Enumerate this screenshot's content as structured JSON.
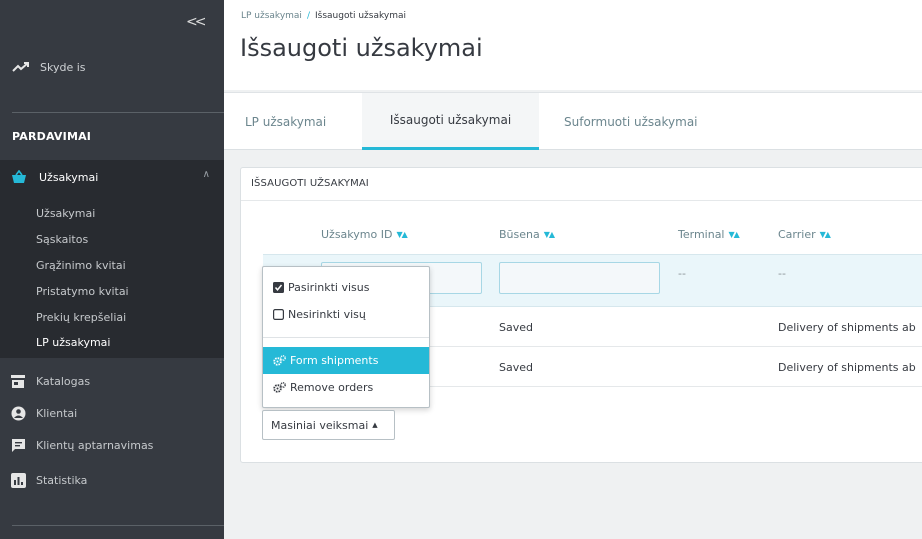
{
  "sidebar": {
    "dashboard_label": "Skyde is",
    "section_header": "PARDAVIMAI",
    "orders_label": "Užsakymai",
    "submenu": [
      "Užsakymai",
      "Sąskaitos",
      "Grąžinimo kvitai",
      "Pristatymo kvitai",
      "Prekių krepšeliai",
      "LP užsakymai"
    ],
    "nav": [
      "Katalogas",
      "Klientai",
      "Klientų aptarnavimas",
      "Statistika"
    ]
  },
  "header": {
    "breadcrumb_parent": "LP užsakymai",
    "breadcrumb_sep": "/",
    "breadcrumb_current": "Išsaugoti užsakymai",
    "title": "Išsaugoti užsakymai"
  },
  "tabs": [
    "LP užsakymai",
    "Išsaugoti užsakymai",
    "Suformuoti užsakymai"
  ],
  "card": {
    "heading": "IŠSAUGOTI UŽSAKYMAI",
    "columns": [
      "Užsakymo ID",
      "Būsena",
      "Terminal",
      "Carrier"
    ],
    "filter_dash": "--",
    "rows": [
      {
        "status": "Saved",
        "carrier": "Delivery of shipments ab"
      },
      {
        "status": "Saved",
        "carrier": "Delivery of shipments ab"
      }
    ]
  },
  "bulk": {
    "button_label": "Masiniai veiksmai",
    "menu": {
      "select_all": "Pasirinkti visus",
      "deselect_all": "Nesirinkti visų",
      "form_shipments": "Form shipments",
      "remove_orders": "Remove orders"
    }
  },
  "colors": {
    "accent": "#25b9d7",
    "sidebar_bg": "#363a41",
    "sidebar_active_bg": "#282b30"
  }
}
